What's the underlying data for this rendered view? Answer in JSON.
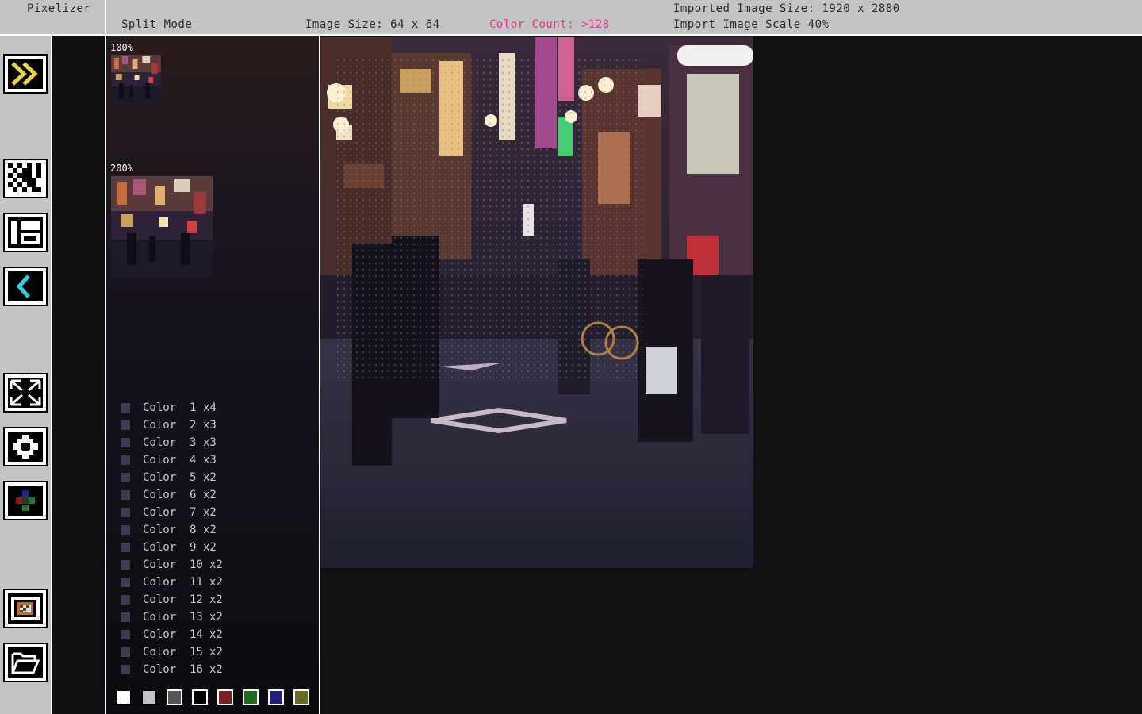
{
  "app": {
    "title": "Pixelizer"
  },
  "header": {
    "mode": "Split Mode",
    "image_size": "Image Size: 64 x 64",
    "color_count": "Color Count: >128",
    "imported_size": "Imported Image Size: 1920 x 2880",
    "import_scale": "Import Image Scale 40%"
  },
  "colors": {
    "accent_pink": "#e8378a",
    "panel_gray": "#c3c3c3"
  },
  "toolbar": [
    {
      "name": "expand-panel-button",
      "icon": "double-chevron-right-icon"
    },
    {
      "name": "checker-pattern-button",
      "icon": "checkerboard-icon"
    },
    {
      "name": "layout-button",
      "icon": "layout-grid-icon"
    },
    {
      "name": "back-button",
      "icon": "chevron-left-icon"
    },
    {
      "name": "fullscreen-button",
      "icon": "expand-arrows-icon"
    },
    {
      "name": "center-button",
      "icon": "crosshair-icon"
    },
    {
      "name": "rgb-channels-button",
      "icon": "rgb-channels-icon"
    },
    {
      "name": "frame-button",
      "icon": "frame-icon"
    },
    {
      "name": "open-folder-button",
      "icon": "folder-open-icon"
    }
  ],
  "previews": [
    {
      "label": "100%"
    },
    {
      "label": "200%"
    }
  ],
  "color_list": [
    {
      "name": "Color  1",
      "count": "x4"
    },
    {
      "name": "Color  2",
      "count": "x3"
    },
    {
      "name": "Color  3",
      "count": "x3"
    },
    {
      "name": "Color  4",
      "count": "x3"
    },
    {
      "name": "Color  5",
      "count": "x2"
    },
    {
      "name": "Color  6",
      "count": "x2"
    },
    {
      "name": "Color  7",
      "count": "x2"
    },
    {
      "name": "Color  8",
      "count": "x2"
    },
    {
      "name": "Color  9",
      "count": "x2"
    },
    {
      "name": "Color  10",
      "count": "x2"
    },
    {
      "name": "Color  11",
      "count": "x2"
    },
    {
      "name": "Color  12",
      "count": "x2"
    },
    {
      "name": "Color  13",
      "count": "x2"
    },
    {
      "name": "Color  14",
      "count": "x2"
    },
    {
      "name": "Color  15",
      "count": "x2"
    },
    {
      "name": "Color  16",
      "count": "x2"
    }
  ],
  "palette": [
    "#ffffff",
    "#c3c3c3",
    "#555555",
    "#000000",
    "#7a1f1f",
    "#1f6b1f",
    "#1f1f7a",
    "#6b6b1f"
  ]
}
